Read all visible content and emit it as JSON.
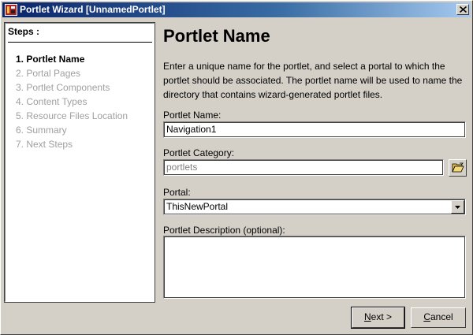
{
  "window": {
    "title": "Portlet Wizard [UnnamedPortlet]",
    "close_label": "×"
  },
  "steps": {
    "title": "Steps :",
    "items": [
      {
        "label": "1. Portlet Name",
        "active": true
      },
      {
        "label": "2. Portal Pages",
        "active": false
      },
      {
        "label": "3. Portlet Components",
        "active": false
      },
      {
        "label": "4. Content Types",
        "active": false
      },
      {
        "label": "5. Resource Files Location",
        "active": false
      },
      {
        "label": "6. Summary",
        "active": false
      },
      {
        "label": "7. Next Steps",
        "active": false
      }
    ]
  },
  "main": {
    "heading": "Portlet Name",
    "description": "Enter a unique name for the portlet, and select a portal to which the portlet should be associated. The portlet name will be used to name the directory that contains wizard-generated portlet files.",
    "portlet_name": {
      "label": "Portlet Name:",
      "value": "Navigation1"
    },
    "portlet_category": {
      "label": "Portlet Category:",
      "value": "portlets"
    },
    "portal": {
      "label": "Portal:",
      "value": "ThisNewPortal"
    },
    "portlet_description": {
      "label": "Portlet Description (optional):",
      "value": ""
    }
  },
  "buttons": {
    "next_mnemonic": "N",
    "next_rest": "ext >",
    "cancel_mnemonic": "C",
    "cancel_rest": "ancel"
  },
  "colors": {
    "title_bar": "#0a246a",
    "window_bg": "#d4d0c8",
    "disabled_text": "#a0a0a0"
  }
}
